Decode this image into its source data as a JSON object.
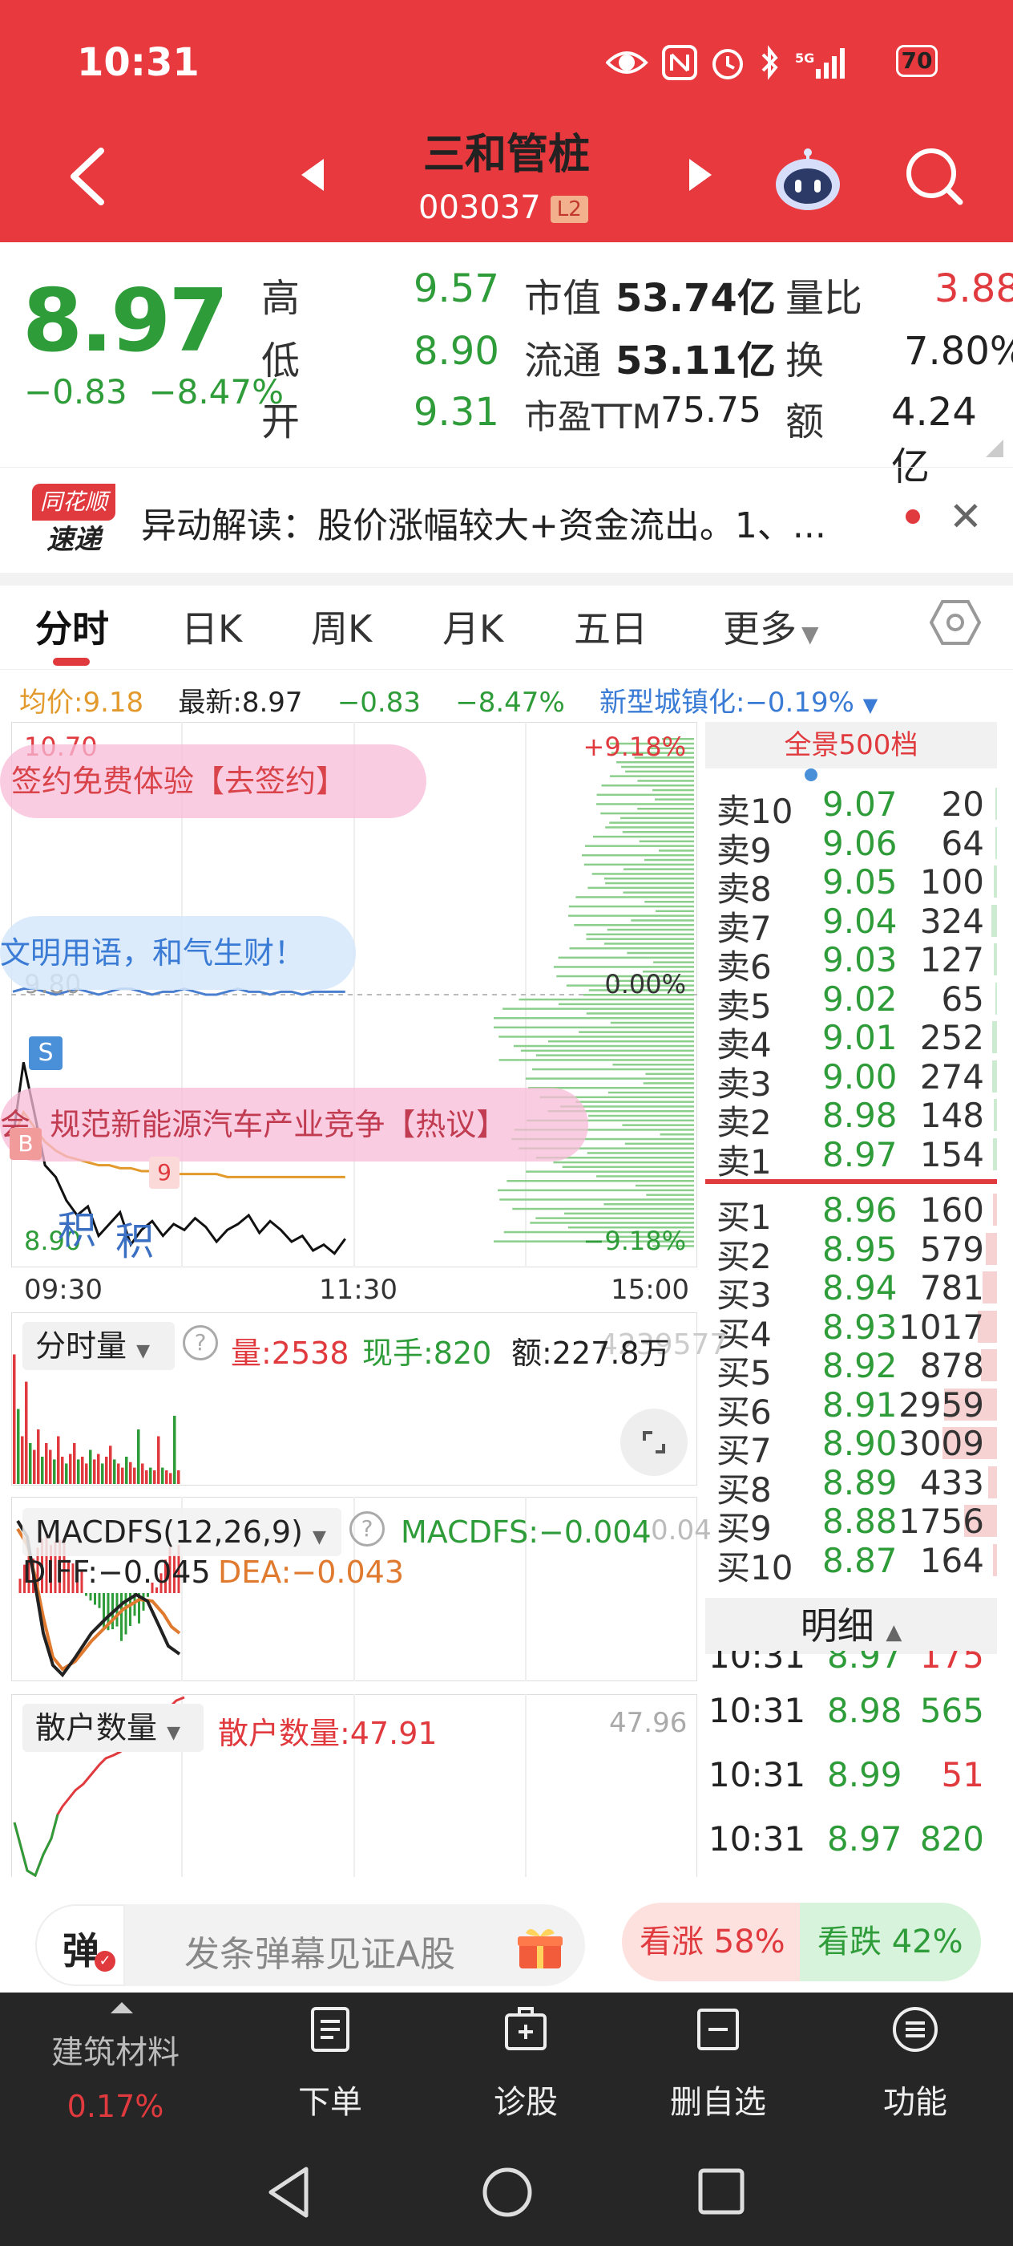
{
  "status": {
    "time": "10:31",
    "battery": "70"
  },
  "header": {
    "title": "三和管桩",
    "code": "003037",
    "badge": "L2"
  },
  "quote": {
    "price": "8.97",
    "change": "−0.83",
    "change_pct": "−8.47%",
    "high_label": "高",
    "high": "9.57",
    "low_label": "低",
    "low": "8.90",
    "open_label": "开",
    "open": "9.31",
    "mcap_label": "市值",
    "mcap": "53.74亿",
    "float_label": "流通",
    "float": "53.11亿",
    "pe_label": "市盈TTM",
    "pe": "75.75",
    "vr_label": "量比",
    "vr": "3.88",
    "turnover_label": "换",
    "turnover": "7.80%",
    "amount_label": "额",
    "amount": "4.24亿"
  },
  "news": {
    "logo_top": "同花顺",
    "logo_bottom": "速递",
    "text": "异动解读：股价涨幅较大+资金流出。1、..."
  },
  "tabs": [
    "分时",
    "日K",
    "周K",
    "月K",
    "五日",
    "更多"
  ],
  "info_row": {
    "avg": "均价:9.18",
    "latest": "最新:8.97",
    "chg": "−0.83",
    "pct": "−8.47%",
    "sector": "新型城镇化:−0.19%"
  },
  "chart_data": {
    "type": "line",
    "title": "",
    "x_ticks": [
      "09:30",
      "11:30",
      "15:00"
    ],
    "y_top": "10.70",
    "y_mid": "9.80",
    "y_bottom": "8.90",
    "pct_top": "+9.18%",
    "pct_mid": "0.00%",
    "pct_bottom": "−9.18%",
    "ylim": [
      8.9,
      10.7
    ],
    "x": [
      "09:30",
      "09:31",
      "09:32",
      "09:33",
      "09:34",
      "09:35",
      "09:36",
      "09:37",
      "09:38",
      "09:39",
      "09:40",
      "09:41",
      "09:42",
      "09:43",
      "09:44",
      "09:45",
      "09:46",
      "09:47",
      "09:48",
      "09:49",
      "09:50",
      "09:51",
      "09:52",
      "09:53",
      "09:54",
      "09:55",
      "09:56",
      "09:57",
      "09:58",
      "09:59",
      "10:00",
      "10:31"
    ],
    "series": [
      {
        "values": [
          9.31,
          9.57,
          9.4,
          9.22,
          9.18,
          9.1,
          9.05,
          9.08,
          8.98,
          9.02,
          9.06,
          8.95,
          9.0,
          9.03,
          8.98,
          9.02,
          9.0,
          9.04,
          9.01,
          8.96,
          9.0,
          9.02,
          9.05,
          8.99,
          9.03,
          9.0,
          8.96,
          8.98,
          8.93,
          8.95,
          8.92,
          8.97
        ]
      },
      {
        "values": [
          9.31,
          9.4,
          9.35,
          9.3,
          9.27,
          9.25,
          9.24,
          9.23,
          9.22,
          9.22,
          9.21,
          9.21,
          9.2,
          9.2,
          9.2,
          9.19,
          9.19,
          9.19,
          9.19,
          9.19,
          9.18,
          9.18,
          9.18,
          9.18,
          9.18,
          9.18,
          9.18,
          9.18,
          9.18,
          9.18,
          9.18,
          9.18
        ]
      }
    ],
    "sector_line": [
      9.81,
      9.82,
      9.82,
      9.81,
      9.8,
      9.81,
      9.82,
      9.81,
      9.8,
      9.81,
      9.82,
      9.82,
      9.81,
      9.8,
      9.81,
      9.81,
      9.82,
      9.81,
      9.8,
      9.8,
      9.81,
      9.82,
      9.81,
      9.81,
      9.8,
      9.81,
      9.81,
      9.8,
      9.81,
      9.81,
      9.81,
      9.81
    ]
  },
  "bubbles": {
    "sign": "签约免费体验【去签约】",
    "civil": "文明用语，和气生财！",
    "hot": "规范新能源汽车产业竞争【热议】",
    "hot_prefix": "会",
    "ji1": "积",
    "ji2": "积",
    "s_tag": "S",
    "b_tag": "B",
    "nine_tag": "9"
  },
  "book": {
    "title": "全景500档",
    "asks": [
      {
        "label": "卖10",
        "price": "9.07",
        "vol": "20",
        "bar": 0.02
      },
      {
        "label": "卖9",
        "price": "9.06",
        "vol": "64",
        "bar": 0.02
      },
      {
        "label": "卖8",
        "price": "9.05",
        "vol": "100",
        "bar": 0.03
      },
      {
        "label": "卖7",
        "price": "9.04",
        "vol": "324",
        "bar": 0.06
      },
      {
        "label": "卖6",
        "price": "9.03",
        "vol": "127",
        "bar": 0.03
      },
      {
        "label": "卖5",
        "price": "9.02",
        "vol": "65",
        "bar": 0.02
      },
      {
        "label": "卖4",
        "price": "9.01",
        "vol": "252",
        "bar": 0.05
      },
      {
        "label": "卖3",
        "price": "9.00",
        "vol": "274",
        "bar": 0.05
      },
      {
        "label": "卖2",
        "price": "8.98",
        "vol": "148",
        "bar": 0.03
      },
      {
        "label": "卖1",
        "price": "8.97",
        "vol": "154",
        "bar": 0.04
      }
    ],
    "bids": [
      {
        "label": "买1",
        "price": "8.96",
        "vol": "160",
        "bar": 0.04
      },
      {
        "label": "买2",
        "price": "8.95",
        "vol": "579",
        "bar": 0.12
      },
      {
        "label": "买3",
        "price": "8.94",
        "vol": "781",
        "bar": 0.15
      },
      {
        "label": "买4",
        "price": "8.93",
        "vol": "1017",
        "bar": 0.2
      },
      {
        "label": "买5",
        "price": "8.92",
        "vol": "878",
        "bar": 0.17
      },
      {
        "label": "买6",
        "price": "8.91",
        "vol": "2959",
        "bar": 0.55
      },
      {
        "label": "买7",
        "price": "8.90",
        "vol": "3009",
        "bar": 0.57
      },
      {
        "label": "买8",
        "price": "8.89",
        "vol": "433",
        "bar": 0.09
      },
      {
        "label": "买9",
        "price": "8.88",
        "vol": "1756",
        "bar": 0.34
      },
      {
        "label": "买10",
        "price": "8.87",
        "vol": "164",
        "bar": 0.04
      }
    ]
  },
  "detail": {
    "title": "明细",
    "partial": {
      "time": "10:31",
      "price": "8.97",
      "vol": "175"
    },
    "rows": [
      {
        "time": "10:31",
        "price": "8.98",
        "vol": "565",
        "color": "#2f9c3a"
      },
      {
        "time": "10:31",
        "price": "8.99",
        "vol": "51",
        "color": "#e03a3e"
      },
      {
        "time": "10:31",
        "price": "8.97",
        "vol": "820",
        "color": "#2f9c3a"
      }
    ]
  },
  "volume_panel": {
    "selector": "分时量",
    "vol": "量:2538",
    "now": "现手:820",
    "amt": "额:227.8万",
    "amt_hidden": "4239577",
    "bars": [
      0.95,
      0.55,
      0.35,
      0.75,
      0.3,
      0.25,
      0.4,
      0.2,
      0.3,
      0.25,
      0.18,
      0.35,
      0.2,
      0.15,
      0.22,
      0.3,
      0.18,
      0.2,
      0.15,
      0.25,
      0.18,
      0.22,
      0.15,
      0.2,
      0.28,
      0.18,
      0.15,
      0.12,
      0.2,
      0.16,
      0.12,
      0.4,
      0.15,
      0.1,
      0.12,
      0.1,
      0.35,
      0.12,
      0.1,
      0.08,
      0.5,
      0.1
    ]
  },
  "macd_panel": {
    "selector": "MACDFS(12,26,9)",
    "macd": "MACDFS:−0.004",
    "diff": "DIFF:−0.045",
    "dea": "DEA:−0.043",
    "right_val": "0.04"
  },
  "retail_panel": {
    "selector": "散户数量",
    "value": "散户数量:47.91",
    "right_val": "47.96"
  },
  "danmu": {
    "icon": "弹",
    "placeholder": "发条弹幕见证A股",
    "up": "看涨 58%",
    "down": "看跌 42%"
  },
  "nav": {
    "sector_name": "建筑材料",
    "sector_pct": "0.17%",
    "order": "下单",
    "diagnose": "诊股",
    "remove_fav": "删自选",
    "functions": "功能"
  },
  "colors": {
    "brand_red": "#e8393e",
    "up": "#e03a3e",
    "down": "#2f9c3a",
    "avg": "#e39a2c",
    "nav_bg": "#262626"
  }
}
